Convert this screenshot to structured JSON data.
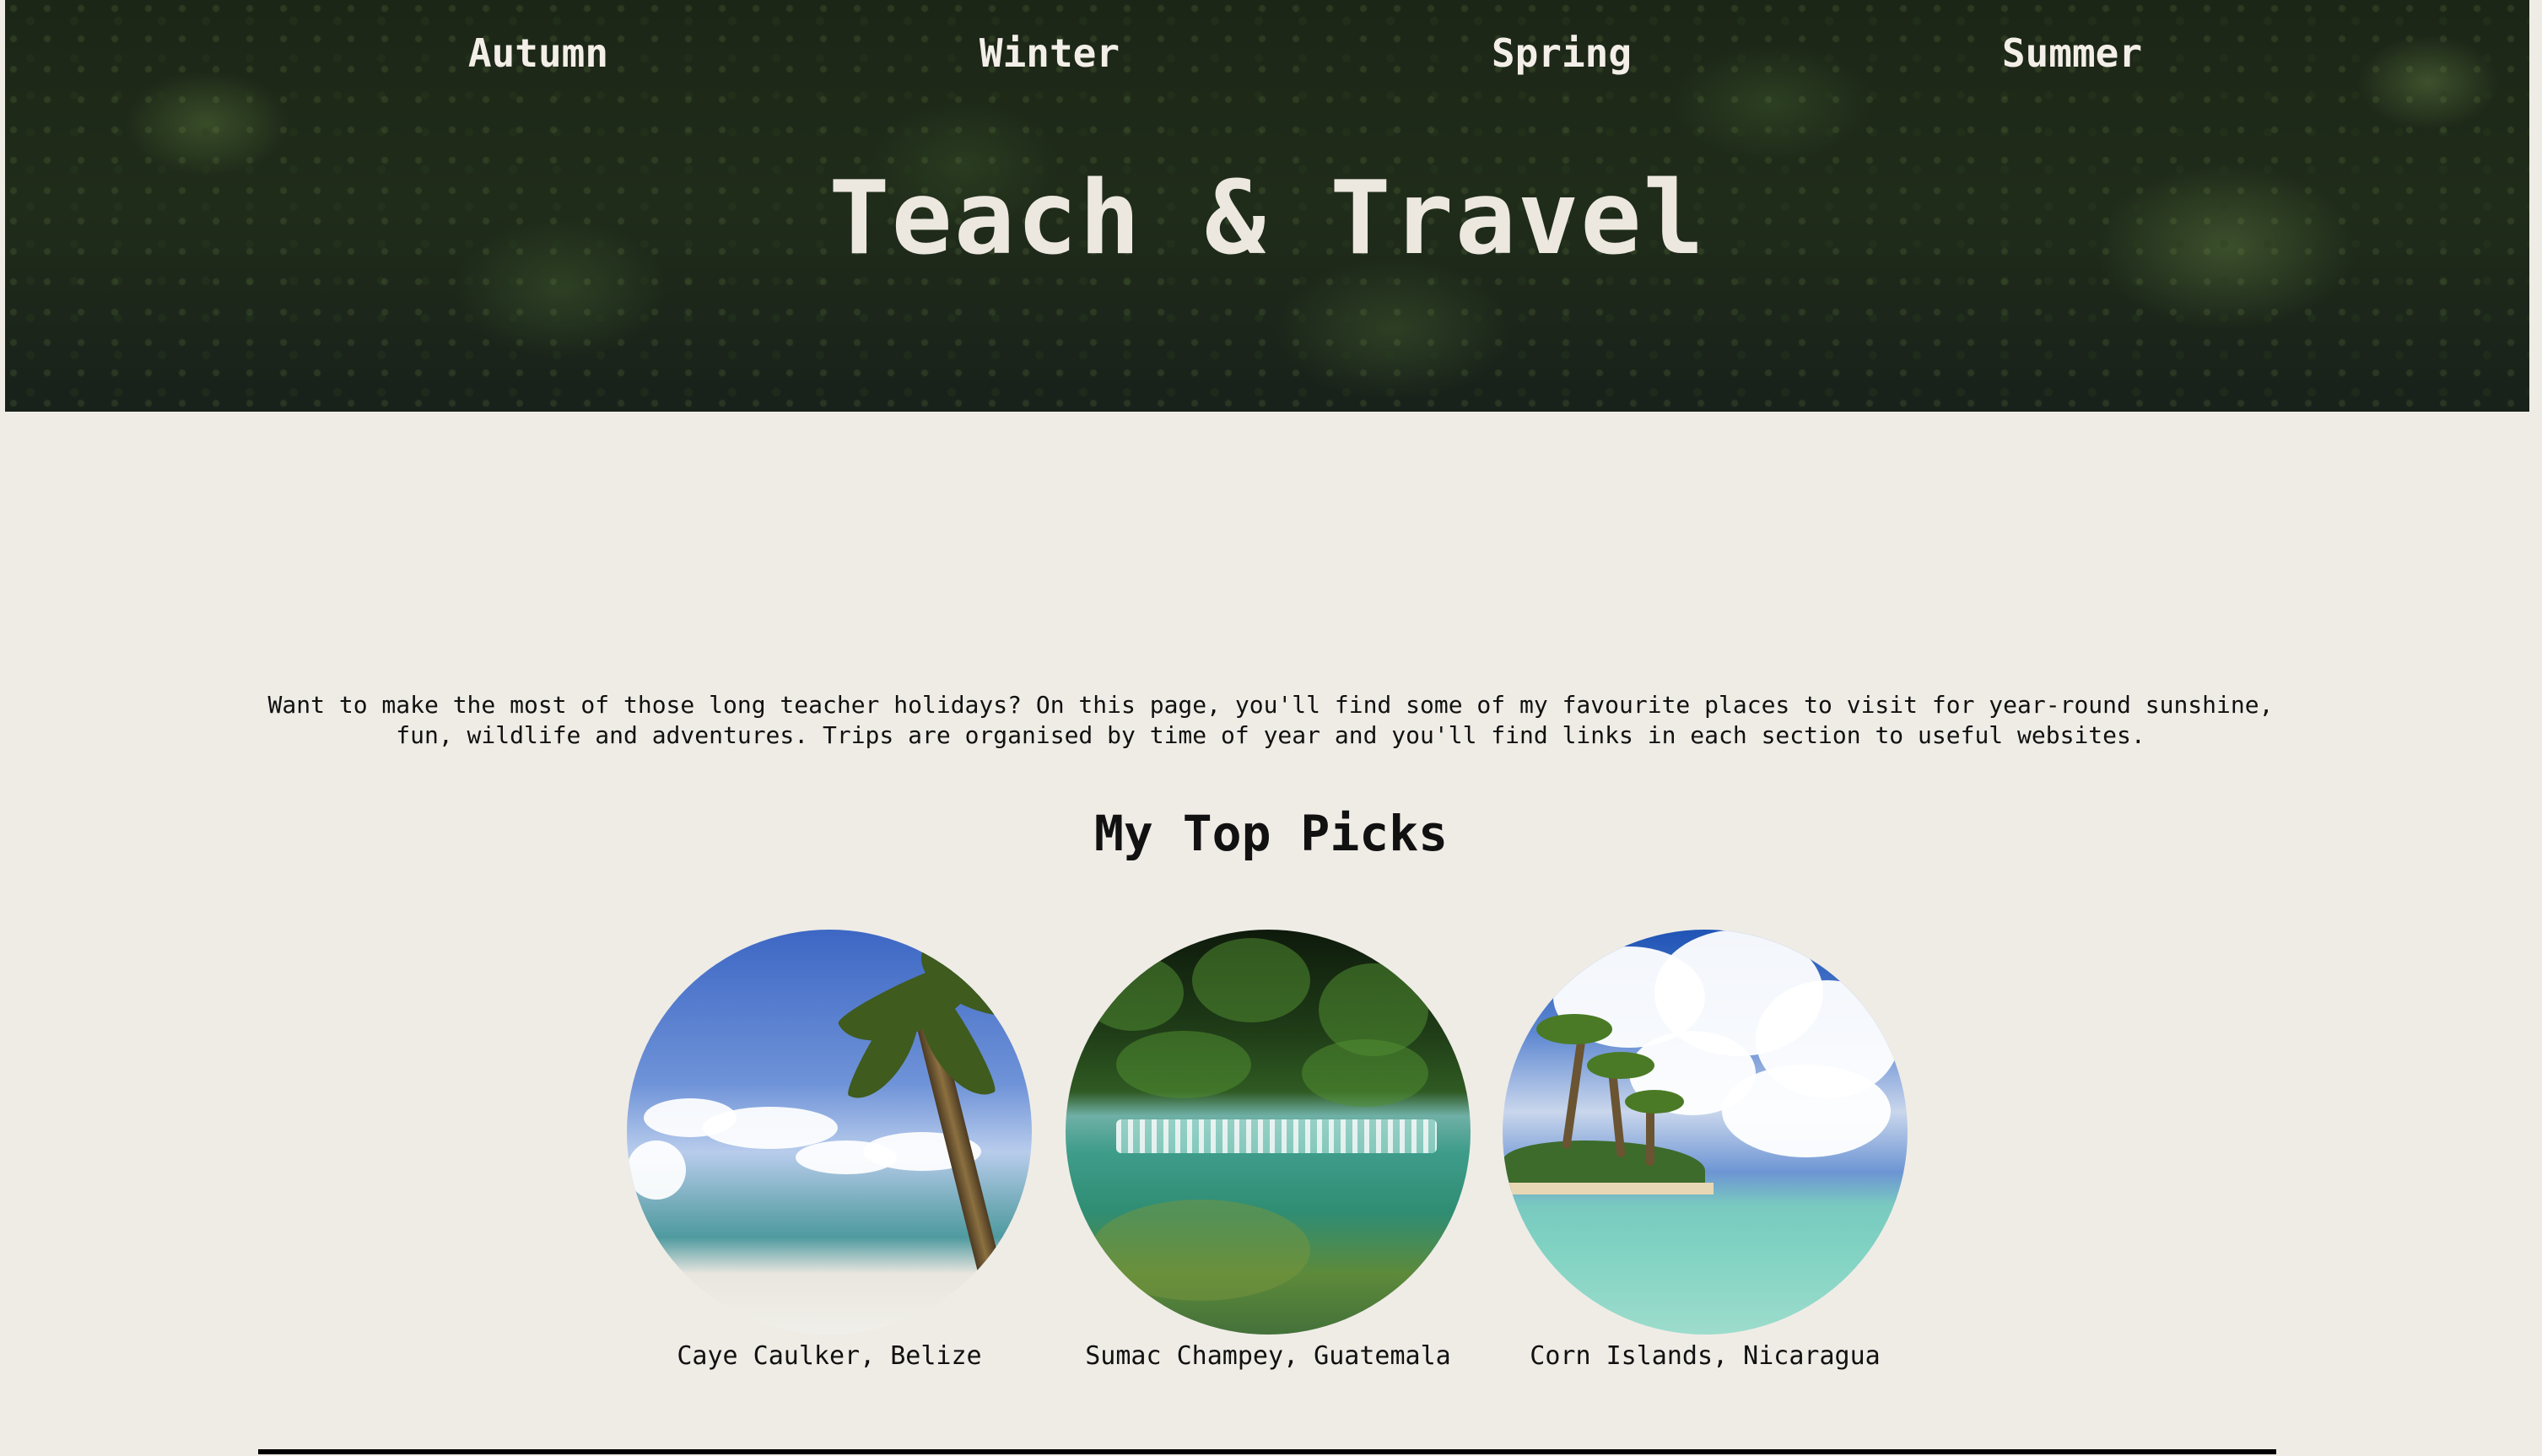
{
  "nav": {
    "items": [
      {
        "label": "Autumn"
      },
      {
        "label": "Winter"
      },
      {
        "label": "Spring"
      },
      {
        "label": "Summer"
      }
    ]
  },
  "hero": {
    "title": "Teach & Travel"
  },
  "intro": {
    "text": "Want to make the most of those long teacher holidays? On this page, you'll find some of my favourite places to visit for year-round sunshine, fun, wildlife and adventures. Trips are organised by time of year and you'll find links in each section to useful websites."
  },
  "top_picks": {
    "heading": "My Top Picks",
    "items": [
      {
        "caption": "Caye Caulker, Belize"
      },
      {
        "caption": "Sumac Champey, Guatemala"
      },
      {
        "caption": "Corn Islands, Nicaragua"
      }
    ]
  }
}
